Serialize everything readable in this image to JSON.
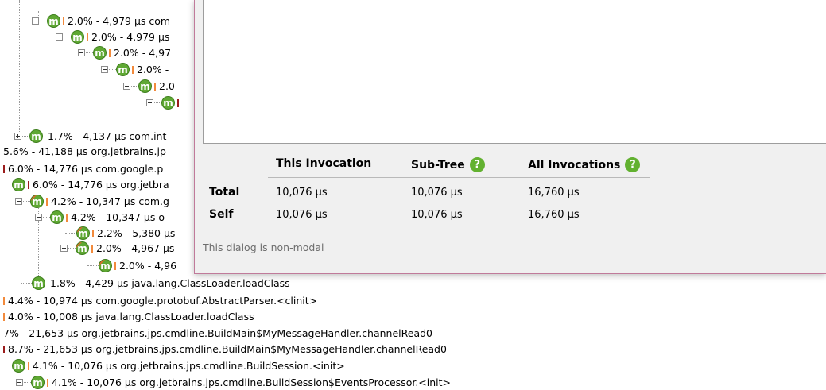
{
  "call_tree": {
    "rows": [
      {
        "text": "2.0% - 4,979 μs com"
      },
      {
        "text": "2.0% - 4,979 μs"
      },
      {
        "text": "2.0% - 4,97"
      },
      {
        "text": "2.0% -"
      },
      {
        "text": "2.0"
      },
      {
        "text": ""
      },
      {
        "text": "1.7% - 4,137 μs com.int"
      },
      {
        "text": "5.6% - 41,188 μs org.jetbrains.jp"
      },
      {
        "text": "6.0% - 14,776 μs com.google.p"
      },
      {
        "text": "6.0% - 14,776 μs org.jetbra"
      },
      {
        "text": "4.2% - 10,347 μs com.g"
      },
      {
        "text": "4.2% - 10,347 μs o"
      },
      {
        "text": "2.2% - 5,380 μs"
      },
      {
        "text": "2.0% - 4,967 μs"
      },
      {
        "text": "2.0% - 4,96"
      },
      {
        "text": "1.8% - 4,429 μs java.lang.ClassLoader.loadClass"
      },
      {
        "text": "4.4% - 10,974 μs com.google.protobuf.AbstractParser.<clinit>"
      },
      {
        "text": "4.0% - 10,008 μs java.lang.ClassLoader.loadClass"
      },
      {
        "text": "7% - 21,653 μs org.jetbrains.jps.cmdline.BuildMain$MyMessageHandler.channelRead0"
      },
      {
        "text": "8.7% - 21,653 μs org.jetbrains.jps.cmdline.BuildMain$MyMessageHandler.channelRead0"
      },
      {
        "text": "4.1% - 10,076 μs org.jetbrains.jps.cmdline.BuildSession.<init>"
      },
      {
        "text": "4.1% - 10,076 μs org.jetbrains.jps.cmdline.BuildSession$EventsProcessor.<init>"
      }
    ],
    "method_icon_letter": "m"
  },
  "dialog": {
    "columns": {
      "this_invocation": "This Invocation",
      "sub_tree": "Sub-Tree",
      "all_invocations": "All Invocations"
    },
    "help_glyph": "?",
    "rows": [
      {
        "label": "Total",
        "this_invocation": "10,076 μs",
        "sub_tree": "10,076 μs",
        "all_invocations": "16,760 μs"
      },
      {
        "label": "Self",
        "this_invocation": "10,076 μs",
        "sub_tree": "10,076 μs",
        "all_invocations": "16,760 μs"
      }
    ],
    "footer_note": "This dialog is non-modal"
  },
  "colors": {
    "method_icon": "#5fa833",
    "hot_marker": "#e0672c",
    "bar_light": "#f28a3c",
    "bar_dark": "#9b1c1c",
    "help_icon": "#62b130",
    "dialog_border": "#c07a9a"
  }
}
